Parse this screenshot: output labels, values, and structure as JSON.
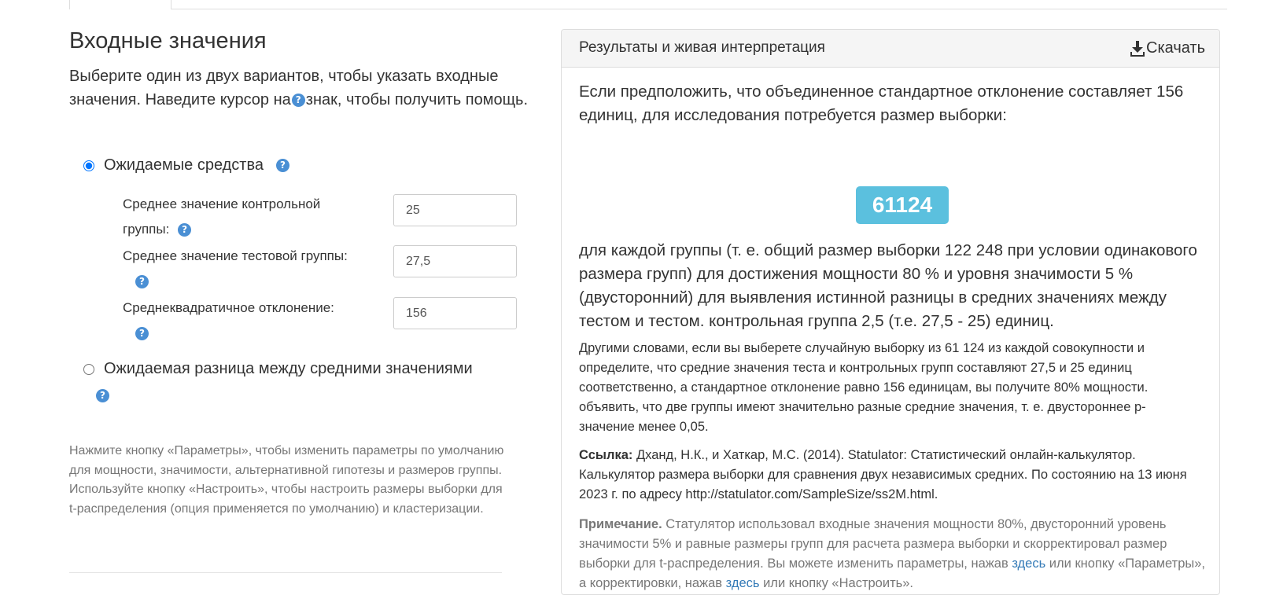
{
  "left": {
    "heading": "Входные значения",
    "intro_before": "Выберите один из двух вариантов, чтобы указать входные значения. Наведите курсор на",
    "intro_icon": "?",
    "intro_after": "знак, чтобы получить помощь.",
    "option_means": {
      "label": "Ожидаемые средства",
      "selected": true,
      "fields": [
        {
          "label": "Среднее значение контрольной группы:",
          "value": "25"
        },
        {
          "label": "Среднее значение тестовой группы:",
          "value": "27,5"
        },
        {
          "label": "Среднеквадратичное отклонение:",
          "value": "156"
        }
      ]
    },
    "option_diff": {
      "label": "Ожидаемая разница между средними значениями",
      "selected": false
    },
    "note": "Нажмите кнопку «Параметры», чтобы изменить параметры по умолчанию для мощности, значимости, альтернативной гипотезы и размеров группы. Используйте кнопку «Настроить», чтобы настроить размеры выборки для t-распределения (опция применяется по умолчанию) и кластеризации."
  },
  "panel": {
    "title": "Результаты и живая интерпретация",
    "download_label": "Скачать",
    "download_icon": "download-icon",
    "lead": "Если предположить, что объединенное стандартное отклонение составляет 156 единиц, для исследования потребуется размер выборки:",
    "sample_size": "61124",
    "result": "для каждой группы (т. е. общий размер выборки 122 248 при условии одинакового размера групп) для достижения мощности 80 % и уровня значимости 5 % (двусторонний) для выявления истинной разницы в средних значениях между тестом и тестом. контрольная группа 2,5 (т.е. 27,5 - 25) единиц.",
    "other_words": "Другими словами, если вы выберете случайную выборку из 61 124 из каждой совокупности и определите, что средние значения теста и контрольных групп составляют 27,5 и 25 единиц соответственно, а стандартное отклонение равно 156 единицам, вы получите 80% мощности. объявить, что две группы имеют значительно разные средние значения, т. е. двустороннее p-значение менее 0,05.",
    "ref_label": "Ссылка:",
    "ref_text": "Дханд, Н.К., и Хаткар, М.С. (2014). Statulator: Статистический онлайн-калькулятор. Калькулятор размера выборки для сравнения двух независимых средних. По состоянию на 13 июня 2023 г. по адресу http://statulator.com/SampleSize/ss2M.html.",
    "note_label": "Примечание.",
    "note_text_1": "Статулятор использовал входные значения мощности 80%, двусторонний уровень значимости 5% и равные размеры групп для расчета размера выборки и скорректировал размер выборки для t-распределения. Вы можете изменить параметры, нажав",
    "note_link_1": "здесь",
    "note_text_2": "или кнопку «Параметры», а корректировки, нажав",
    "note_link_2": "здесь",
    "note_text_3": "или кнопку «Настроить»."
  },
  "colors": {
    "help_icon": "#4a8fd4",
    "badge": "#5bc0de",
    "link": "#337ab7"
  }
}
